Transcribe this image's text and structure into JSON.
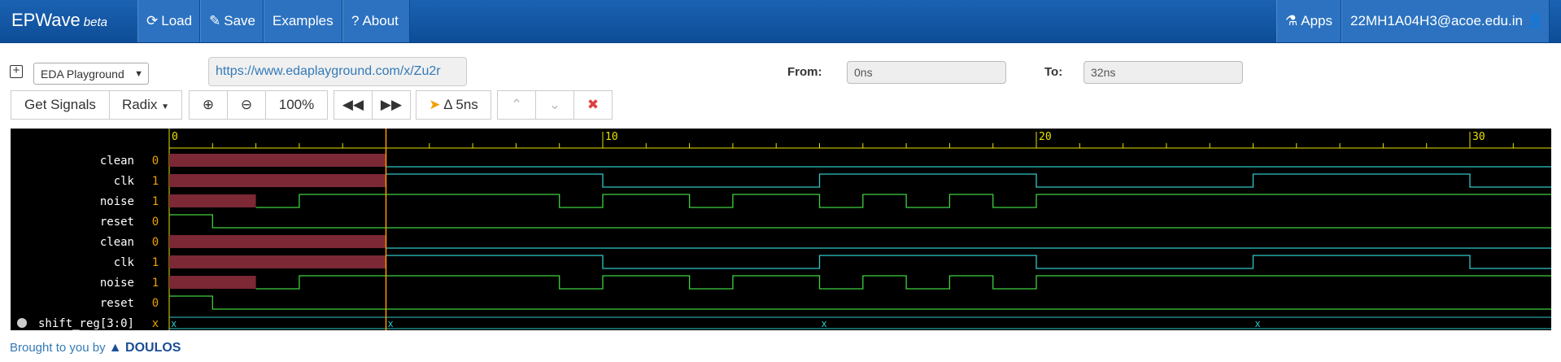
{
  "navbar": {
    "brand": "EPWave",
    "beta": "beta",
    "load": "Load",
    "save": "Save",
    "examples": "Examples",
    "about": "About",
    "apps": "Apps",
    "user": "22MH1A04H3@acoe.edu.in"
  },
  "controls": {
    "source_select": "EDA Playground",
    "url": "https://www.edaplayground.com/x/Zu2r",
    "from_label": "From:",
    "from_value": "0ns",
    "to_label": "To:",
    "to_value": "32ns"
  },
  "toolbar": {
    "get_signals": "Get Signals",
    "radix": "Radix",
    "zoom": "100%",
    "delta": "Δ 5ns"
  },
  "wave": {
    "time_start": 0,
    "time_end": 32,
    "axis_labels": [
      "0",
      "10",
      "20",
      "30"
    ],
    "cursor_time": 5,
    "signals": [
      {
        "name": "clean",
        "value": "0"
      },
      {
        "name": "clk",
        "value": "1"
      },
      {
        "name": "noise",
        "value": "1"
      },
      {
        "name": "reset",
        "value": "0"
      },
      {
        "name": "clean",
        "value": "0"
      },
      {
        "name": "clk",
        "value": "1"
      },
      {
        "name": "noise",
        "value": "1"
      },
      {
        "name": "reset",
        "value": "0"
      },
      {
        "name": "shift_reg[3:0]",
        "value": "x"
      }
    ],
    "bus_values": [
      "x",
      "x",
      "x",
      "x"
    ]
  },
  "footer": {
    "text": "Brought to you by",
    "logo": "DOULOS"
  },
  "colors": {
    "navbar": "#1b62b2",
    "x_fill": "#7c2835",
    "wave_green": "#3fcf3f",
    "wave_cyan": "#2fc7c7",
    "axis_yellow": "#e8e000",
    "cursor_orange": "#ff9a00",
    "value_orange": "#e8a000"
  }
}
